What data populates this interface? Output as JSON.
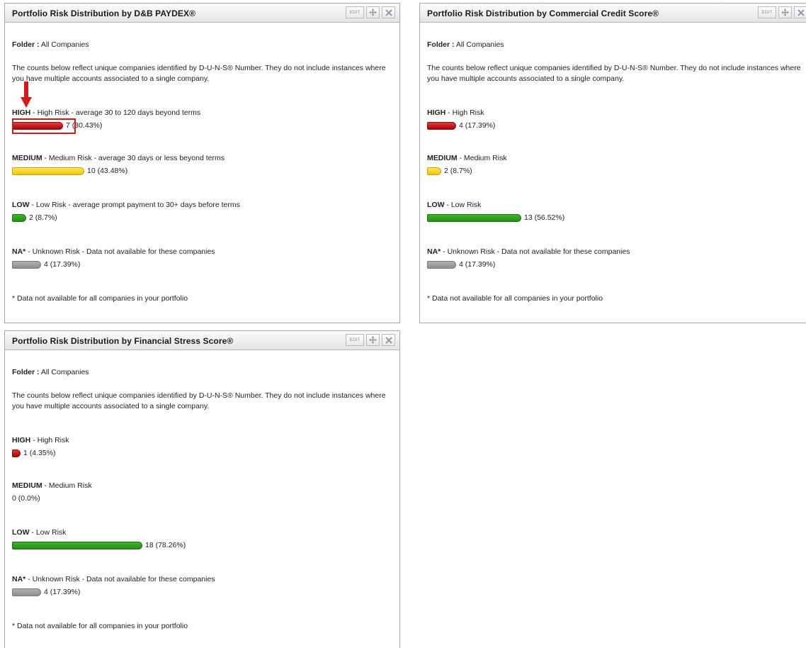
{
  "panels": [
    {
      "title": "Portfolio Risk Distribution by D&B PAYDEX®",
      "edit_label": "EDIT",
      "folder_label": "Folder :",
      "folder_value": "All Companies",
      "description": "The counts below reflect unique companies identified by D-U-N-S® Number. They do not include instances where you have multiple accounts associated to a single company.",
      "categories": [
        {
          "label": "HIGH",
          "desc": " - High Risk - average 30 to 120 days beyond terms",
          "count": 7,
          "percent": 30.43,
          "display": "7 (30.43%)",
          "color": "#b00000"
        },
        {
          "label": "MEDIUM",
          "desc": " - Medium Risk - average 30 days or less beyond terms",
          "count": 10,
          "percent": 43.48,
          "display": "10 (43.48%)",
          "color": "#f2c400"
        },
        {
          "label": "LOW",
          "desc": " - Low Risk - average prompt payment to 30+ days before terms",
          "count": 2,
          "percent": 8.7,
          "display": "2 (8.7%)",
          "color": "#239015"
        },
        {
          "label": "NA*",
          "desc": " - Unknown Risk - Data not available for these companies",
          "count": 4,
          "percent": 17.39,
          "display": "4 (17.39%)",
          "color": "#8e8e8e"
        }
      ],
      "footnote": "* Data not available for all companies in your portfolio"
    },
    {
      "title": "Portfolio Risk Distribution by Commercial Credit Score®",
      "edit_label": "EDIT",
      "folder_label": "Folder :",
      "folder_value": "All Companies",
      "description": "The counts below reflect unique companies identified by D-U-N-S® Number. They do not include instances where you have multiple accounts associated to a single company.",
      "categories": [
        {
          "label": "HIGH",
          "desc": " - High Risk",
          "count": 4,
          "percent": 17.39,
          "display": "4 (17.39%)",
          "color": "#b00000"
        },
        {
          "label": "MEDIUM",
          "desc": " - Medium Risk",
          "count": 2,
          "percent": 8.7,
          "display": "2 (8.7%)",
          "color": "#f2c400"
        },
        {
          "label": "LOW",
          "desc": " - Low Risk",
          "count": 13,
          "percent": 56.52,
          "display": "13 (56.52%)",
          "color": "#239015"
        },
        {
          "label": "NA*",
          "desc": " - Unknown Risk - Data not available for these companies",
          "count": 4,
          "percent": 17.39,
          "display": "4 (17.39%)",
          "color": "#8e8e8e"
        }
      ],
      "footnote": "* Data not available for all companies in your portfolio"
    },
    {
      "title": "Portfolio Risk Distribution by Financial Stress Score®",
      "edit_label": "EDIT",
      "folder_label": "Folder :",
      "folder_value": "All Companies",
      "description": "The counts below reflect unique companies identified by D-U-N-S® Number. They do not include instances where you have multiple accounts associated to a single company.",
      "categories": [
        {
          "label": "HIGH",
          "desc": " - High Risk",
          "count": 1,
          "percent": 4.35,
          "display": "1 (4.35%)",
          "color": "#b00000"
        },
        {
          "label": "MEDIUM",
          "desc": " - Medium Risk",
          "count": 0,
          "percent": 0.0,
          "display": "0 (0.0%)",
          "color": "#f2c400"
        },
        {
          "label": "LOW",
          "desc": " - Low Risk",
          "count": 18,
          "percent": 78.26,
          "display": "18 (78.26%)",
          "color": "#239015"
        },
        {
          "label": "NA*",
          "desc": " - Unknown Risk - Data not available for these companies",
          "count": 4,
          "percent": 17.39,
          "display": "4 (17.39%)",
          "color": "#8e8e8e"
        }
      ],
      "footnote": "* Data not available for all companies in your portfolio"
    }
  ],
  "annotation": {
    "highlight_color": "#d11a1a",
    "target": "panels.0.categories.0"
  }
}
